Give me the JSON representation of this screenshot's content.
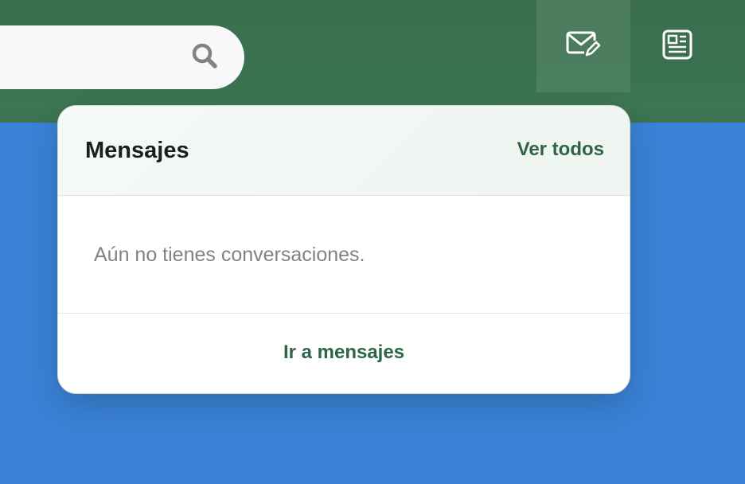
{
  "header": {
    "icons": [
      "search-icon",
      "mail-edit-icon",
      "newspaper-icon"
    ],
    "colors": {
      "bar": "#3b6e4e",
      "accent": "#2e6446",
      "background": "#3a82d6"
    }
  },
  "messages_popover": {
    "title": "Mensajes",
    "see_all_label": "Ver todos",
    "empty_text": "Aún no tienes conversaciones.",
    "go_to_label": "Ir a mensajes"
  }
}
